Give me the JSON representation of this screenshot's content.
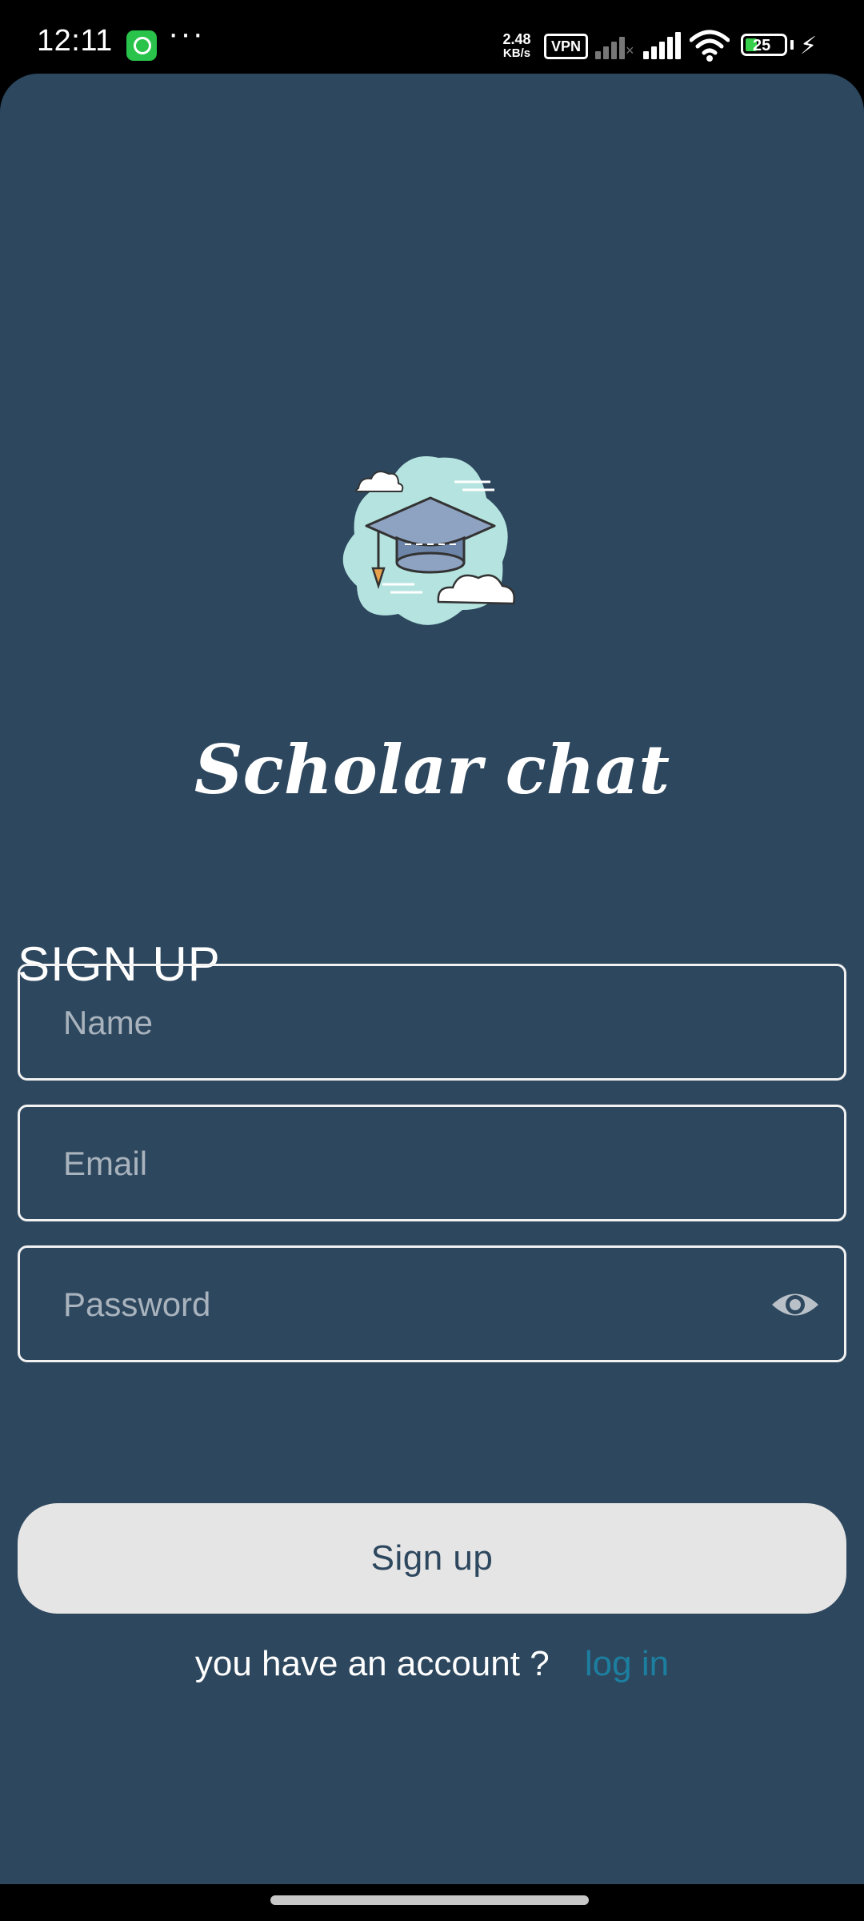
{
  "status_bar": {
    "time": "12:11",
    "dots": "···",
    "net_speed": "2.48",
    "net_speed_unit": "KB/s",
    "vpn": "VPN",
    "battery": "25",
    "colors": {
      "whatsapp": "#29c24a",
      "battery_fill": "#37d04a"
    }
  },
  "app": {
    "title": "Scholar chat",
    "logo_icon": "graduation-cap-cloud-icon",
    "background": "#2d475e"
  },
  "form": {
    "heading": "SIGN UP",
    "name_placeholder": "Name",
    "email_placeholder": "Email",
    "password_placeholder": "Password",
    "password_toggle_icon": "eye-icon",
    "submit_label": "Sign up"
  },
  "footer": {
    "prompt": "you have an account ?",
    "login_link": "log in",
    "link_color": "#1c7fa0"
  }
}
